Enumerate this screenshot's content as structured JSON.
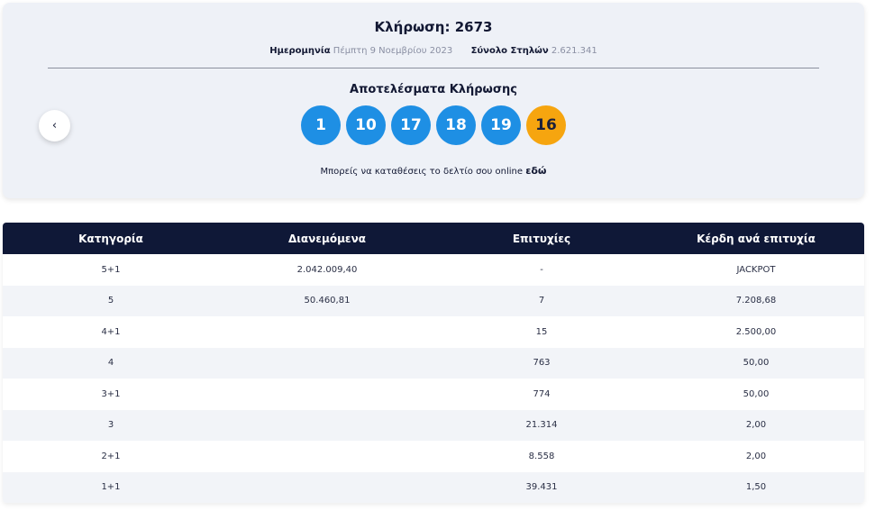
{
  "draw": {
    "title": "Κλήρωση: 2673",
    "date_label": "Ημερομηνία",
    "date_value": "Πέμπτη 9 Νοεμβρίου 2023",
    "columns_label": "Σύνολο Στηλών",
    "columns_value": "2.621.341",
    "results_title": "Αποτελέσματα Κλήρωσης",
    "prev_icon": "‹",
    "numbers": [
      "1",
      "10",
      "17",
      "18",
      "19"
    ],
    "bonus": "16",
    "online_text": "Μπορείς να καταθέσεις το δελτίο σου online",
    "online_link": "εδώ"
  },
  "colors": {
    "main_ball": "#1e8fe4",
    "bonus_ball": "#f6a50f",
    "header_bg": "#0f1837"
  },
  "table": {
    "headers": [
      "Κατηγορία",
      "Διανεμόμενα",
      "Επιτυχίες",
      "Κέρδη ανά επιτυχία"
    ],
    "rows": [
      [
        "5+1",
        "2.042.009,40",
        "-",
        "JACKPOT"
      ],
      [
        "5",
        "50.460,81",
        "7",
        "7.208,68"
      ],
      [
        "4+1",
        "",
        "15",
        "2.500,00"
      ],
      [
        "4",
        "",
        "763",
        "50,00"
      ],
      [
        "3+1",
        "",
        "774",
        "50,00"
      ],
      [
        "3",
        "",
        "21.314",
        "2,00"
      ],
      [
        "2+1",
        "",
        "8.558",
        "2,00"
      ],
      [
        "1+1",
        "",
        "39.431",
        "1,50"
      ]
    ]
  }
}
